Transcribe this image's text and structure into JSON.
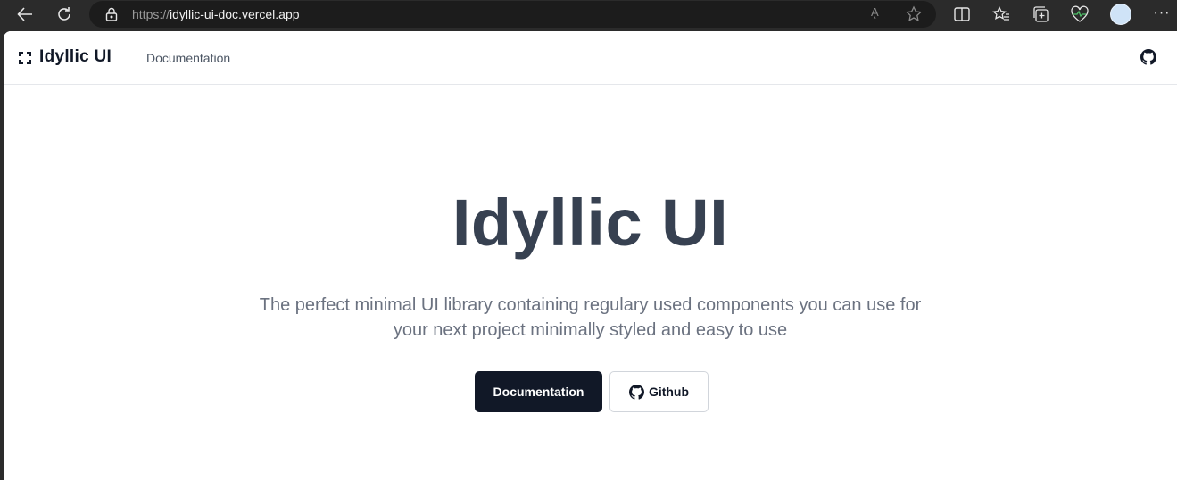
{
  "browser": {
    "url_scheme": "https://",
    "url_host": "idyllic-ui-doc.vercel.app",
    "read_aloud_label": "Aͅ",
    "icons": [
      "back-icon",
      "refresh-icon",
      "lock-icon",
      "read-aloud-icon",
      "favorite-star-icon",
      "split-screen-icon",
      "favorites-icon",
      "collections-icon",
      "browser-essentials-icon",
      "profile-avatar",
      "more-icon"
    ],
    "more_label": "···"
  },
  "site": {
    "logo_text": "Idyllic UI",
    "nav": {
      "documentation": "Documentation"
    },
    "github_icon": "github-icon"
  },
  "hero": {
    "title": "Idyllic UI",
    "subtitle": "The perfect minimal UI library containing regulary used components you can use for your next project minimally styled and easy to use",
    "primary_button": "Documentation",
    "secondary_button": "Github"
  },
  "colors": {
    "chrome_bg": "#2b2b2b",
    "primary_button_bg": "#111827",
    "title_color": "#374151",
    "subtitle_color": "#6b7280"
  }
}
